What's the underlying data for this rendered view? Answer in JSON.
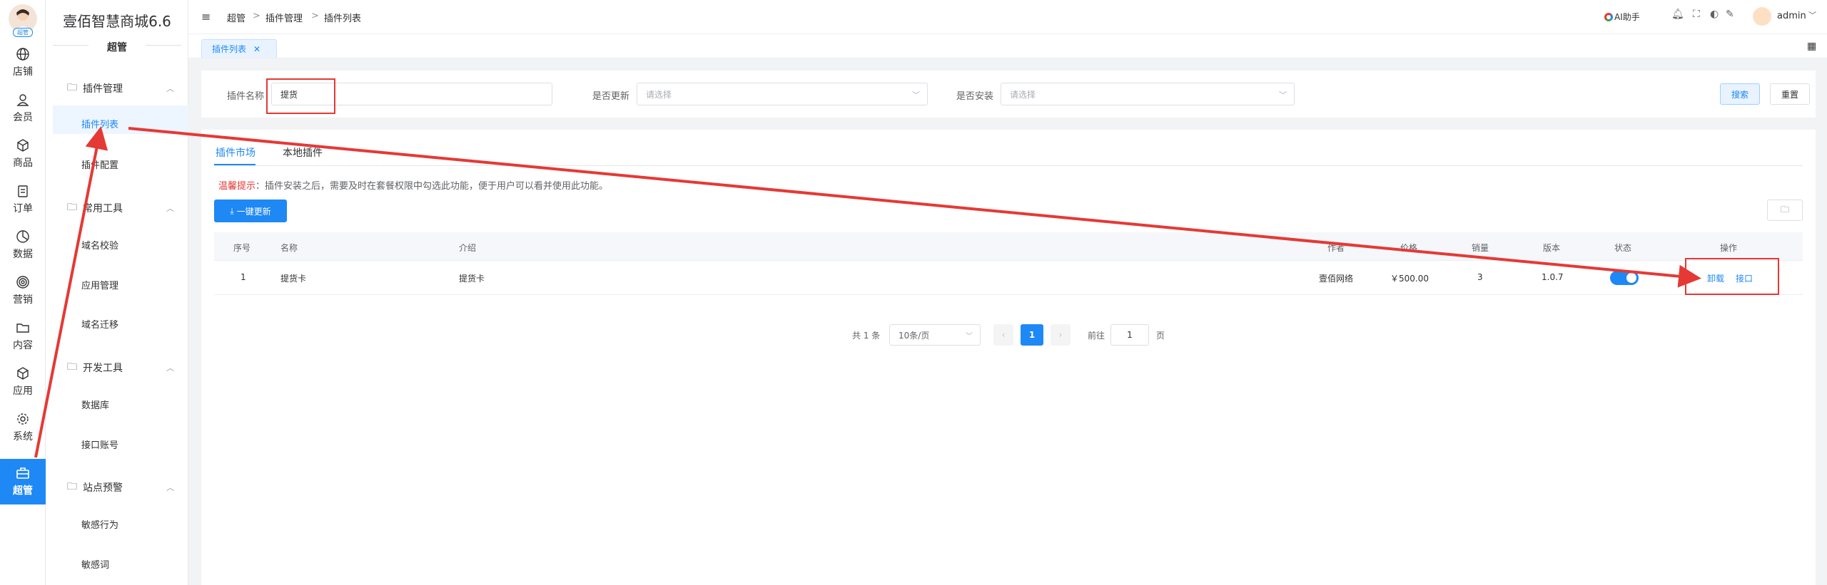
{
  "rail": {
    "badge": "超管",
    "items": [
      {
        "label": "店铺",
        "icon": "globe-icon"
      },
      {
        "label": "会员",
        "icon": "user-icon"
      },
      {
        "label": "商品",
        "icon": "cube-icon"
      },
      {
        "label": "订单",
        "icon": "clipboard-icon"
      },
      {
        "label": "数据",
        "icon": "chart-pie-icon"
      },
      {
        "label": "营销",
        "icon": "target-icon"
      },
      {
        "label": "内容",
        "icon": "folder-icon"
      },
      {
        "label": "应用",
        "icon": "box-icon"
      },
      {
        "label": "系统",
        "icon": "gear-icon"
      },
      {
        "label": "超管",
        "icon": "briefcase-icon"
      }
    ]
  },
  "submenu": {
    "brand": "壹佰智慧商城6.6",
    "title": "超管",
    "groups": [
      {
        "label": "插件管理",
        "items": [
          "插件列表",
          "插件配置"
        ]
      },
      {
        "label": "常用工具",
        "items": [
          "域名校验",
          "应用管理",
          "域名迁移"
        ]
      },
      {
        "label": "开发工具",
        "items": [
          "数据库",
          "接口账号"
        ]
      },
      {
        "label": "站点预警",
        "items": [
          "敏感行为",
          "敏感词"
        ]
      }
    ]
  },
  "breadcrumb": [
    "超管",
    "插件管理",
    "插件列表"
  ],
  "topbar": {
    "ai_label": "AI助手",
    "user": "admin"
  },
  "open_tab": "插件列表",
  "filter": {
    "name_label": "插件名称",
    "name_value": "提货",
    "update_label": "是否更新",
    "update_placeholder": "请选择",
    "install_label": "是否安装",
    "install_placeholder": "请选择",
    "search_btn": "搜索",
    "reset_btn": "重置"
  },
  "tabs": [
    "插件市场",
    "本地插件"
  ],
  "tip": {
    "prefix": "温馨提示",
    "text": "：插件安装之后，需要及时在套餐权限中勾选此功能，便于用户可以看并使用此功能。"
  },
  "update_btn": "一键更新",
  "table": {
    "headers": [
      "序号",
      "名称",
      "介绍",
      "作者",
      "价格",
      "销量",
      "版本",
      "状态",
      "操作"
    ],
    "rows": [
      {
        "no": "1",
        "name": "提货卡",
        "intro": "提货卡",
        "author": "壹佰网络",
        "price": "￥500.00",
        "sales": "3",
        "version": "1.0.7",
        "enabled": true,
        "actions": [
          "卸载",
          "接口"
        ]
      }
    ]
  },
  "pagination": {
    "total": "共 1 条",
    "page_size": "10条/页",
    "current": "1",
    "goto": "前往",
    "goto_value": "1",
    "page_unit": "页"
  },
  "colors": {
    "accent": "#1e88f5",
    "annotation": "#e53935"
  }
}
